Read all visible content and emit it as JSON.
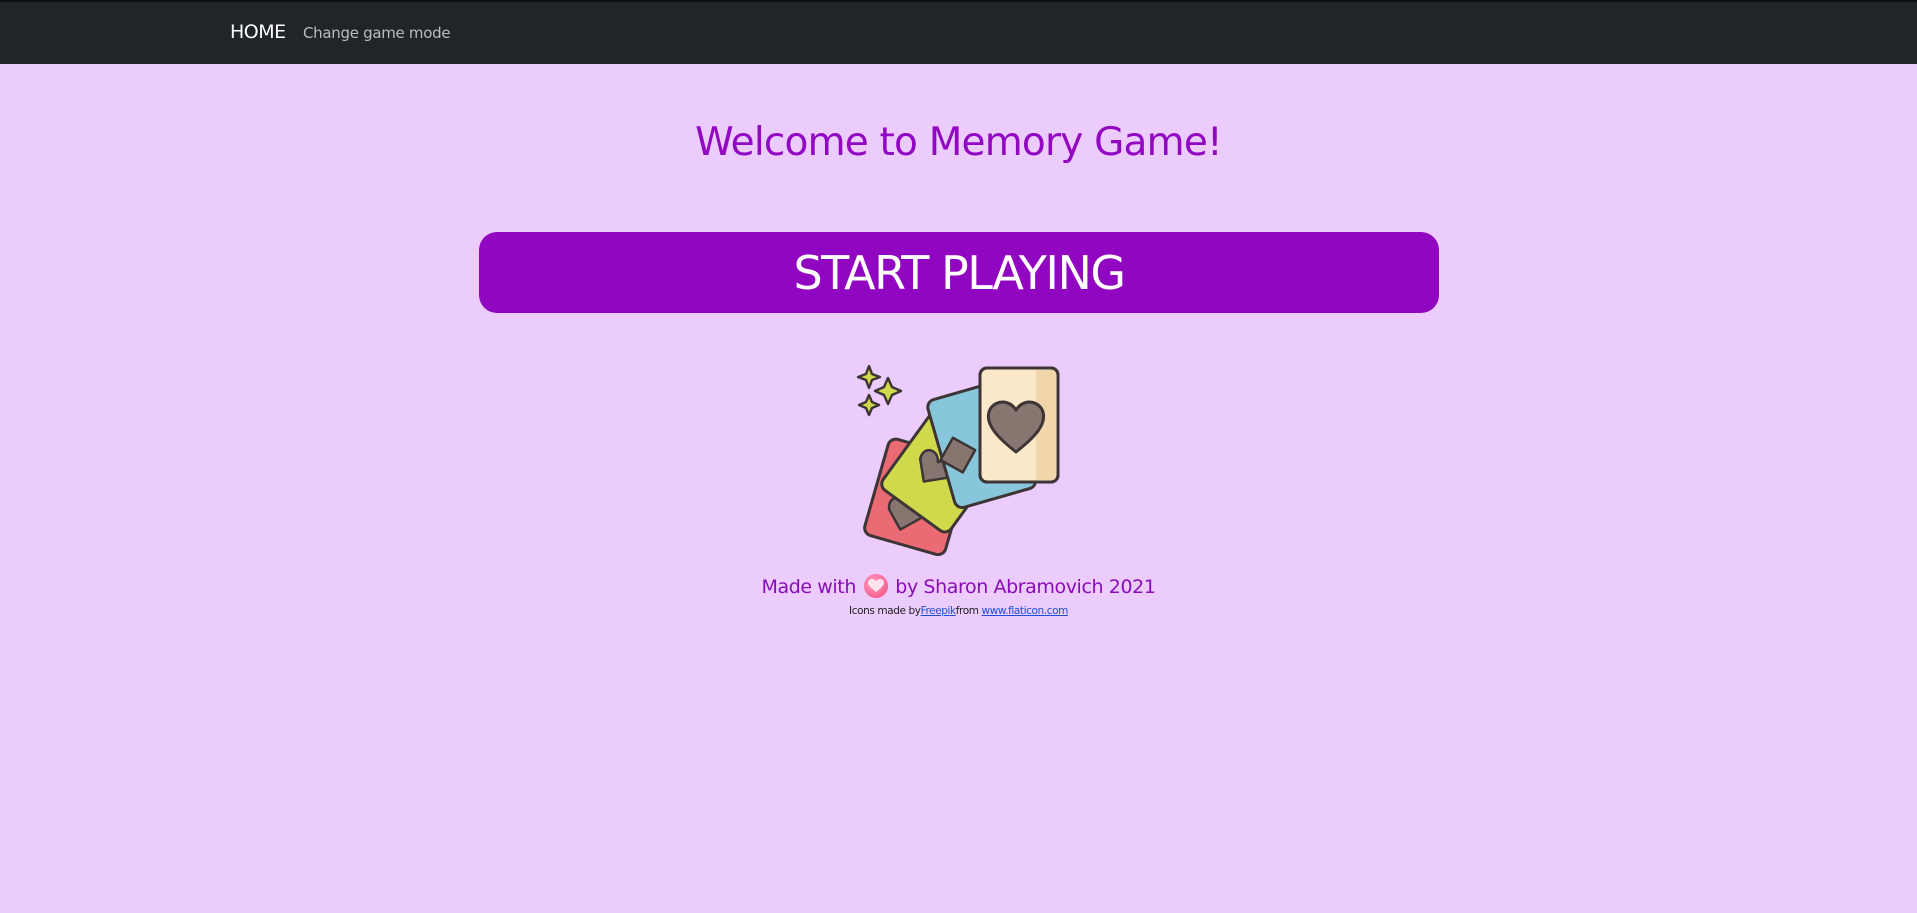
{
  "nav": {
    "home_label": "HOME",
    "mode_label": "Change game mode"
  },
  "main": {
    "title": "Welcome to Memory Game!",
    "start_label": "START PLAYING",
    "illustration_icon": "playing-cards-icon"
  },
  "footer": {
    "made_with": "Made with",
    "heart_icon": "heart-icon",
    "author": "by Sharon Abramovich 2021",
    "credits_prefix": "Icons made by",
    "freepik_link": "Freepik",
    "credits_from": "from",
    "flaticon_link": "www.flaticon.com"
  },
  "colors": {
    "background": "#ebccfc",
    "navbar": "#212529",
    "accent": "#9106c1",
    "link": "#1a4fd6"
  }
}
